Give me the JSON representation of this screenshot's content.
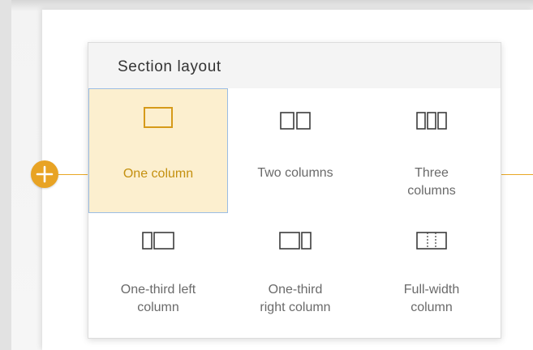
{
  "colors": {
    "accent": "#e8a324",
    "selected_background": "#fcefcf",
    "selected_border": "#9bbde4",
    "selected_text": "#c4900f",
    "icon_stroke": "#3c3c3c",
    "label_text": "#6a6a6a"
  },
  "add_section": {
    "icon": "plus-icon"
  },
  "section_layout": {
    "title": "Section layout",
    "options": [
      {
        "label": "One column",
        "icon": "one-column-icon",
        "selected": true
      },
      {
        "label": "Two columns",
        "icon": "two-columns-icon",
        "selected": false
      },
      {
        "label": "Three\ncolumns",
        "icon": "three-columns-icon",
        "selected": false
      },
      {
        "label": "One-third left\ncolumn",
        "icon": "one-third-left-column-icon",
        "selected": false
      },
      {
        "label": "One-third\nright column",
        "icon": "one-third-right-column-icon",
        "selected": false
      },
      {
        "label": "Full-width\ncolumn",
        "icon": "full-width-column-icon",
        "selected": false
      }
    ]
  }
}
